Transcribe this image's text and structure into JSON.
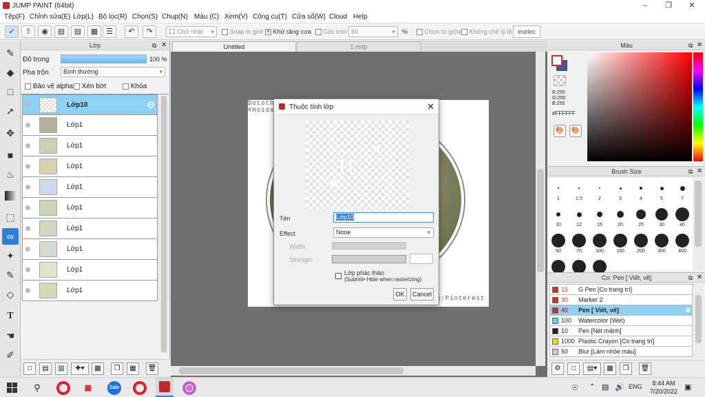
{
  "window": {
    "title": "JUMP PAINT (64bit)"
  },
  "menu": [
    "Tệp(F)",
    "Chỉnh sửa(E)",
    "Lớp(L)",
    "Bộ lọc(R)",
    "Chọn(S)",
    "Chụp(N)",
    "Màu (C)",
    "Xem(V)",
    "Công cụ(T)",
    "Cửa sổ(W)",
    "Cloud",
    "Help"
  ],
  "toolbar": {
    "shape_select": "Chữ nhật",
    "snap_to_grid": "Snap to grid",
    "anti_alias": "Khử răng cưa",
    "corner_round": "Góc tròn",
    "corner_value": "60",
    "percent": "%",
    "select_center": "Chọn từ giữa",
    "no_ratio_limit": "Không chế tỷ lệ",
    "deselect": "eselec"
  },
  "layer_panel": {
    "title": "Lớp",
    "opacity_label": "Độ trong",
    "opacity_value": "100 %",
    "opacity_fraction": 1.0,
    "blend_label": "Pha trộn",
    "blend_value": "Bình thường",
    "protect_alpha": "Bảo vệ alpha",
    "clip": "Xén bớt",
    "lock": "Khóa",
    "layers": [
      "Lớp10",
      "Lớp1",
      "Lớp1",
      "Lớp1",
      "Lớp1",
      "Lớp1",
      "Lớp1",
      "Lớp1",
      "Lớp1",
      "Lớp1"
    ]
  },
  "tabs": [
    "Untitled",
    "1.mdp"
  ],
  "canvas_text": {
    "top_left_1": "Dototh",
    "top_left_2": "#Hoida",
    "bottom_right": "g:Pinterest"
  },
  "dialog": {
    "title": "Thuộc tính lớp",
    "name_label": "Tên",
    "name_value": "Lớp10",
    "effect_label": "Effect",
    "effect_value": "None",
    "width_label": "Width",
    "strength_label": "Strength",
    "draft_label": "Lớp phác thảo",
    "draft_note": "(Submit• Hide when rasterizing)",
    "ok": "OK",
    "cancel": "Cancel"
  },
  "color_panel": {
    "title": "Màu",
    "r": "R:255",
    "g": "G:255",
    "b": "B:255",
    "hex": "#FFFFFF",
    "foreground": "#e8261f",
    "background": "#3b5998"
  },
  "brush_size_panel": {
    "title": "Brush Size",
    "sizes": [
      "1",
      "1.5",
      "2",
      "3",
      "4",
      "5",
      "7",
      "10",
      "12",
      "15",
      "20",
      "25",
      "30",
      "40",
      "50",
      "70",
      "100",
      "150",
      "200",
      "300",
      "400",
      "",
      "",
      ""
    ]
  },
  "brush_panel": {
    "title": "Co: Pen [ Viết, vẽ]",
    "items": [
      {
        "size": "15",
        "name": "G Pen [Co trang trí]",
        "color": "#e8261f"
      },
      {
        "size": "30",
        "name": "Marker 2",
        "color": "#e8261f"
      },
      {
        "size": "40",
        "name": "Pen [ Viết, vẽ]",
        "color": "#e8261f"
      },
      {
        "size": "100",
        "name": "Watercolor (Wet)",
        "color": "#6ad0f0"
      },
      {
        "size": "10",
        "name": "Pen [Nét mảnh]",
        "color": "#222222"
      },
      {
        "size": "1000",
        "name": "Plastic Crayon [Co trang trí]",
        "color": "#f3dd1a"
      },
      {
        "size": "50",
        "name": "Blur [Làm nhòe màu]",
        "color": "#f0b6d8"
      }
    ]
  },
  "taskbar": {
    "lang": "ENG",
    "time": "8:44 AM",
    "date": "7/20/2022"
  }
}
